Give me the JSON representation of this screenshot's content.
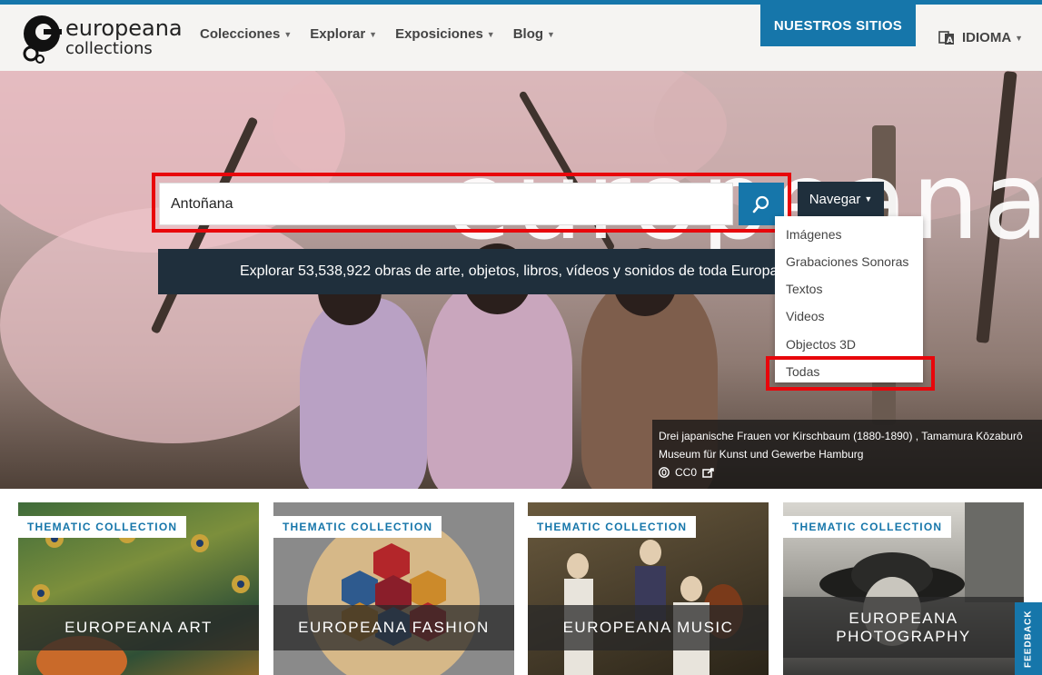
{
  "header": {
    "logo_line1": "europeana",
    "logo_line2": "collections",
    "nav": [
      {
        "label": "Colecciones"
      },
      {
        "label": "Explorar"
      },
      {
        "label": "Exposiciones"
      },
      {
        "label": "Blog"
      }
    ],
    "sites_button": "NUESTROS SITIOS",
    "language_label": "IDIOMA"
  },
  "hero": {
    "watermark": "europeana",
    "search": {
      "value": "Antoñana",
      "button_icon": "search-icon"
    },
    "browse_button": "Navegar",
    "browse_menu": [
      {
        "label": "Imágenes"
      },
      {
        "label": "Grabaciones Sonoras"
      },
      {
        "label": "Textos"
      },
      {
        "label": "Videos"
      },
      {
        "label": "Objectos 3D"
      },
      {
        "label": "Todas"
      }
    ],
    "explore_text": "Explorar 53,538,922 obras de arte, objetos, libros, vídeos y sonidos de toda Europa",
    "caption": {
      "title": "Drei japanische Frauen vor Kirschbaum (1880-1890) , Tamamura Kōzaburō",
      "institution": "Museum für Kunst und Gewerbe Hamburg",
      "license": "CC0"
    }
  },
  "cards": [
    {
      "tag": "THEMATIC COLLECTION",
      "title": "EUROPEANA ART"
    },
    {
      "tag": "THEMATIC COLLECTION",
      "title": "EUROPEANA FASHION"
    },
    {
      "tag": "THEMATIC COLLECTION",
      "title": "EUROPEANA MUSIC"
    },
    {
      "tag": "THEMATIC COLLECTION",
      "title": "EUROPEANA PHOTOGRAPHY"
    }
  ],
  "feedback": "FEEDBACK",
  "colors": {
    "accent": "#1676aa",
    "dark": "#1f2f3c",
    "highlight": "#e8060b"
  }
}
